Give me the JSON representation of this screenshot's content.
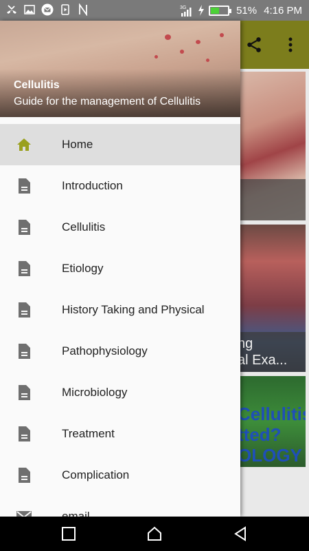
{
  "status_bar": {
    "battery_percent": "51%",
    "time": "4:16 PM",
    "network": "3G",
    "battery_level": 0.51,
    "notification_icons": [
      "missed-call-icon",
      "image-icon",
      "mail-icon",
      "video-icon",
      "n-icon"
    ]
  },
  "drawer": {
    "header": {
      "title": "Cellulitis",
      "subtitle": "Guide for the management of Cellulitis"
    },
    "items": [
      {
        "label": "Home",
        "icon": "home-icon",
        "selected": true
      },
      {
        "label": "Introduction",
        "icon": "document-icon"
      },
      {
        "label": "Cellulitis",
        "icon": "document-icon"
      },
      {
        "label": "Etiology",
        "icon": "document-icon"
      },
      {
        "label": "History Taking and Physical",
        "icon": "document-icon"
      },
      {
        "label": "Pathophysiology",
        "icon": "document-icon"
      },
      {
        "label": "Microbiology",
        "icon": "document-icon"
      },
      {
        "label": "Treatment",
        "icon": "document-icon"
      },
      {
        "label": "Complication",
        "icon": "document-icon"
      },
      {
        "label": "email",
        "icon": "mail-icon"
      }
    ]
  },
  "background": {
    "toolbar_actions": [
      "share-icon",
      "more-vert-icon"
    ],
    "card2_caption": "ng\nal Exa...",
    "card3_text": "Cellulitis\ntted?\nOLOGY"
  },
  "colors": {
    "accent": "#9aa01e",
    "toolbar": "#7c7d1c",
    "selected_bg": "#dedede"
  }
}
